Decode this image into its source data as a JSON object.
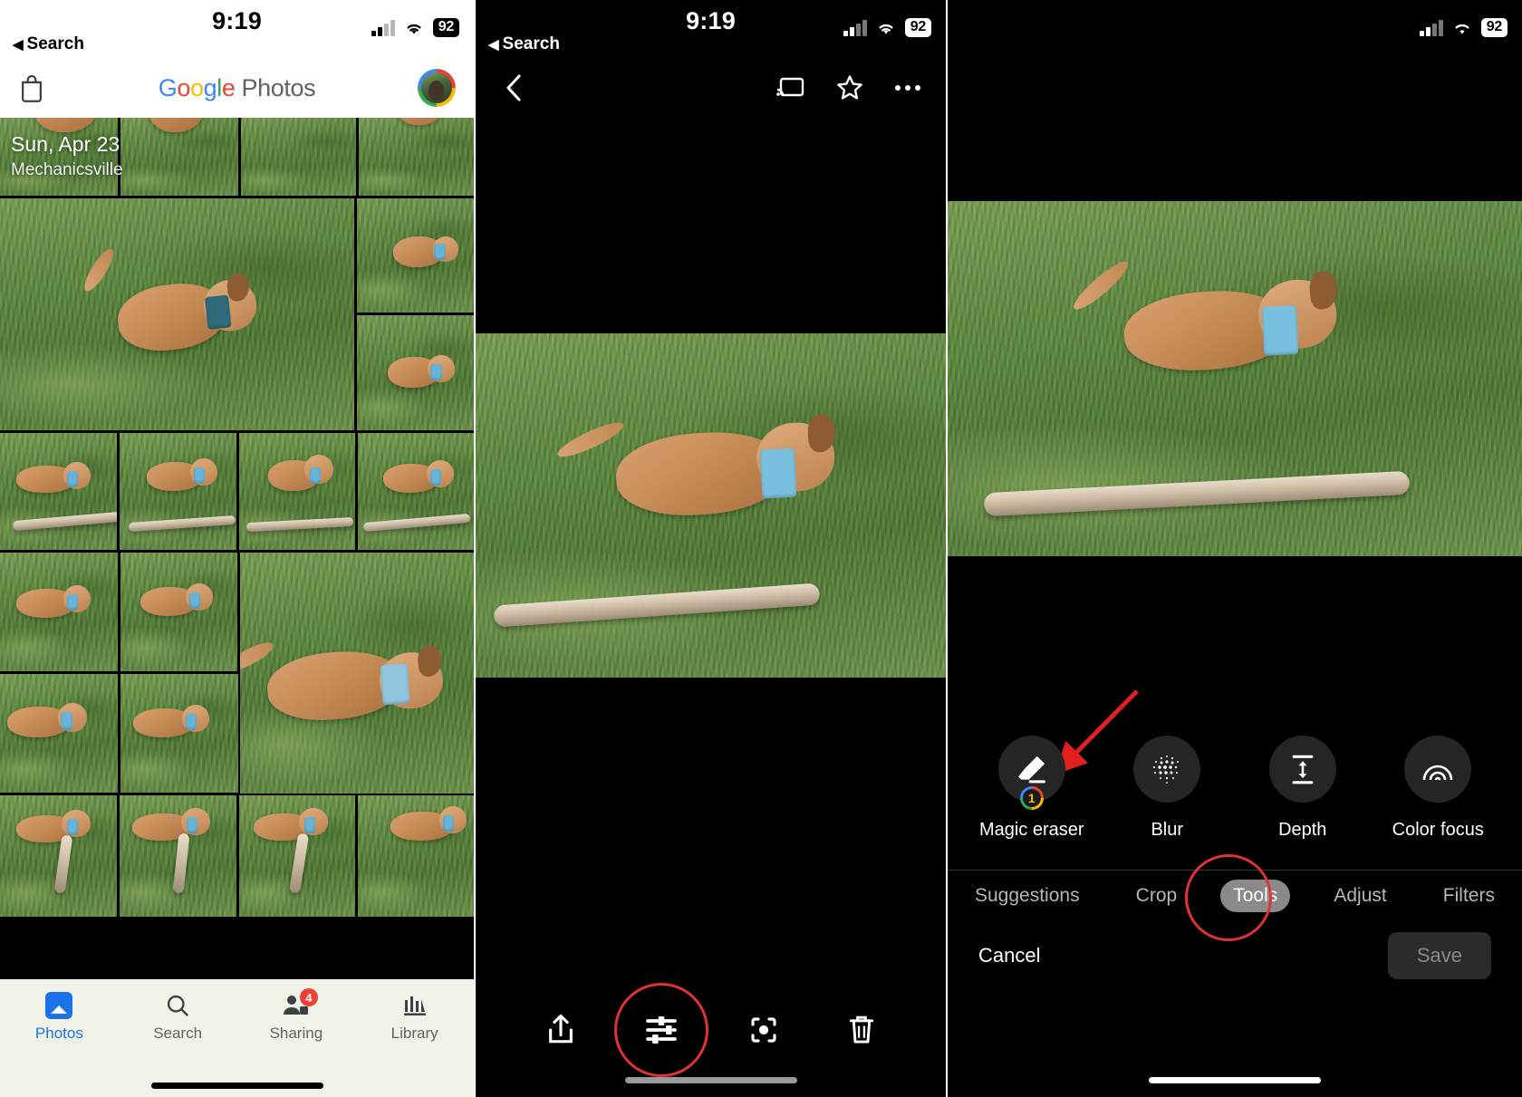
{
  "status_bar": {
    "time": "9:19",
    "back_label": "Search",
    "battery": "92",
    "signal_icon": "cellular-bars-icon",
    "wifi_icon": "wifi-icon"
  },
  "panel1": {
    "header": {
      "store_icon": "shopping-bag-icon",
      "logo": {
        "g": "G",
        "o1": "o",
        "o2": "o",
        "g2": "g",
        "l": "l",
        "e": "e",
        "photos": "Photos"
      },
      "avatar": "account-avatar"
    },
    "grid": {
      "date": "Sun, Apr 23",
      "location": "Mechanicsville"
    },
    "bottom_nav": [
      {
        "label": "Photos",
        "icon": "photos-icon",
        "active": true,
        "badge": ""
      },
      {
        "label": "Search",
        "icon": "search-icon",
        "active": false,
        "badge": ""
      },
      {
        "label": "Sharing",
        "icon": "sharing-icon",
        "active": false,
        "badge": "4"
      },
      {
        "label": "Library",
        "icon": "library-icon",
        "active": false,
        "badge": ""
      }
    ]
  },
  "panel2": {
    "top_bar": {
      "back_icon": "chevron-left-icon",
      "cast_icon": "cast-icon",
      "favorite_icon": "star-icon",
      "more_icon": "more-options-icon"
    },
    "bottom_bar": [
      {
        "icon": "share-icon",
        "name": "share-button",
        "highlighted": false
      },
      {
        "icon": "edit-sliders-icon",
        "name": "edit-button",
        "highlighted": true
      },
      {
        "icon": "lens-icon",
        "name": "lens-button",
        "highlighted": false
      },
      {
        "icon": "trash-icon",
        "name": "delete-button",
        "highlighted": false
      }
    ]
  },
  "panel3": {
    "tools": [
      {
        "label": "Magic eraser",
        "icon": "eraser-icon",
        "badge": "1"
      },
      {
        "label": "Blur",
        "icon": "blur-dots-icon",
        "badge": ""
      },
      {
        "label": "Depth",
        "icon": "depth-icon",
        "badge": ""
      },
      {
        "label": "Color focus",
        "icon": "color-focus-icon",
        "badge": ""
      }
    ],
    "edit_tabs": [
      {
        "label": "Suggestions",
        "selected": false
      },
      {
        "label": "Crop",
        "selected": false
      },
      {
        "label": "Tools",
        "selected": true
      },
      {
        "label": "Adjust",
        "selected": false
      },
      {
        "label": "Filters",
        "selected": false
      }
    ],
    "cancel_label": "Cancel",
    "save_label": "Save"
  },
  "annotations": {
    "accent_color": "#d33333",
    "arrow": "red-arrow-pointing-to-magic-eraser"
  }
}
